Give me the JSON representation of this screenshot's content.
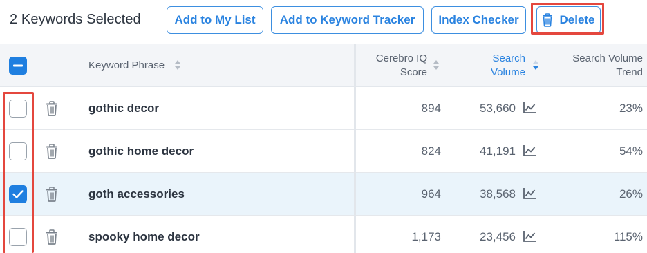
{
  "toolbar": {
    "selected_count": "2 Keywords Selected",
    "add_to_list_label": "Add to My List",
    "add_to_tracker_label": "Add to Keyword Tracker",
    "index_checker_label": "Index Checker",
    "delete_label": "Delete"
  },
  "table": {
    "columns": {
      "keyword_phrase": "Keyword Phrase",
      "cerebro_iq_line1": "Cerebro IQ",
      "cerebro_iq_line2": "Score",
      "search_volume_line1": "Search",
      "search_volume_line2": "Volume",
      "sv_trend_line1": "Search Volume",
      "sv_trend_line2": "Trend"
    },
    "sort": {
      "column": "Search Volume",
      "direction": "descending"
    },
    "rows": [
      {
        "keyword": "gothic decor",
        "cerebro_iq": "894",
        "search_volume": "53,660",
        "trend": "23%",
        "checked": false
      },
      {
        "keyword": "gothic home decor",
        "cerebro_iq": "824",
        "search_volume": "41,191",
        "trend": "54%",
        "checked": false
      },
      {
        "keyword": "goth accessories",
        "cerebro_iq": "964",
        "search_volume": "38,568",
        "trend": "26%",
        "checked": true
      },
      {
        "keyword": "spooky home decor",
        "cerebro_iq": "1,173",
        "search_volume": "23,456",
        "trend": "115%",
        "checked": false
      }
    ]
  },
  "colors": {
    "accent_blue": "#2a83e0",
    "highlight_red": "#e4473e",
    "header_bg": "#f3f5f8",
    "selected_row_bg": "#eaf4fb"
  },
  "icons": {
    "delete": "trash-icon",
    "trend": "line-chart-icon",
    "sort": "sort-arrows-icon",
    "checkbox_state_header": "indeterminate"
  }
}
